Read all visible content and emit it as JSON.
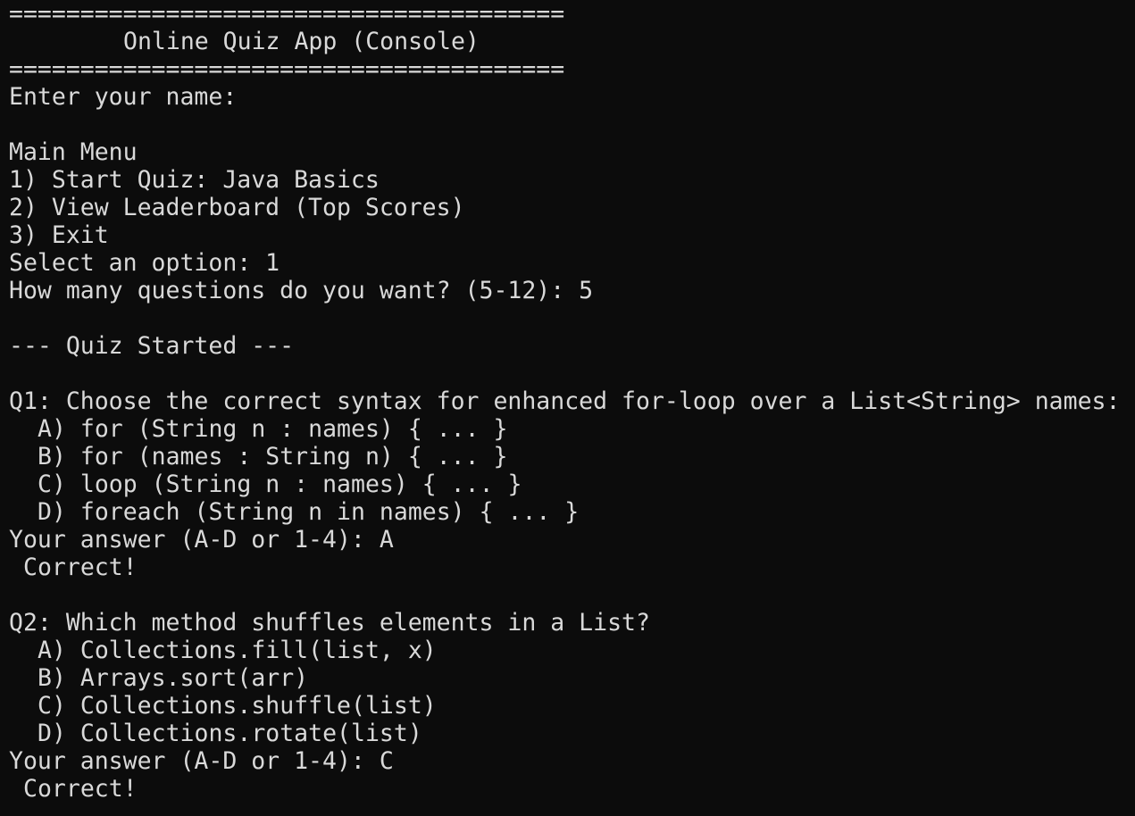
{
  "header": {
    "rule_top": "=======================================",
    "title": "Online Quiz App (Console)",
    "rule_bottom": "======================================="
  },
  "prompt_name": "Enter your name:",
  "menu": {
    "heading": "Main Menu",
    "items": [
      "1) Start Quiz: Java Basics",
      "2) View Leaderboard (Top Scores)",
      "3) Exit"
    ],
    "select_prompt": "Select an option: 1",
    "count_prompt": "How many questions do you want? (5-12): 5"
  },
  "quiz_started": "--- Quiz Started ---",
  "questions": [
    {
      "question": "Q1: Choose the correct syntax for enhanced for-loop over a List<String> names:",
      "options": [
        "A) for (String n : names) { ... }",
        "B) for (names : String n) { ... }",
        "C) loop (String n : names) { ... }",
        "D) foreach (String n in names) { ... }"
      ],
      "answer": "Your answer (A-D or 1-4): A",
      "result": "Correct!"
    },
    {
      "question": "Q2: Which method shuffles elements in a List?",
      "options": [
        "A) Collections.fill(list, x)",
        "B) Arrays.sort(arr)",
        "C) Collections.shuffle(list)",
        "D) Collections.rotate(list)"
      ],
      "answer": "Your answer (A-D or 1-4): C",
      "result": "Correct!"
    }
  ]
}
